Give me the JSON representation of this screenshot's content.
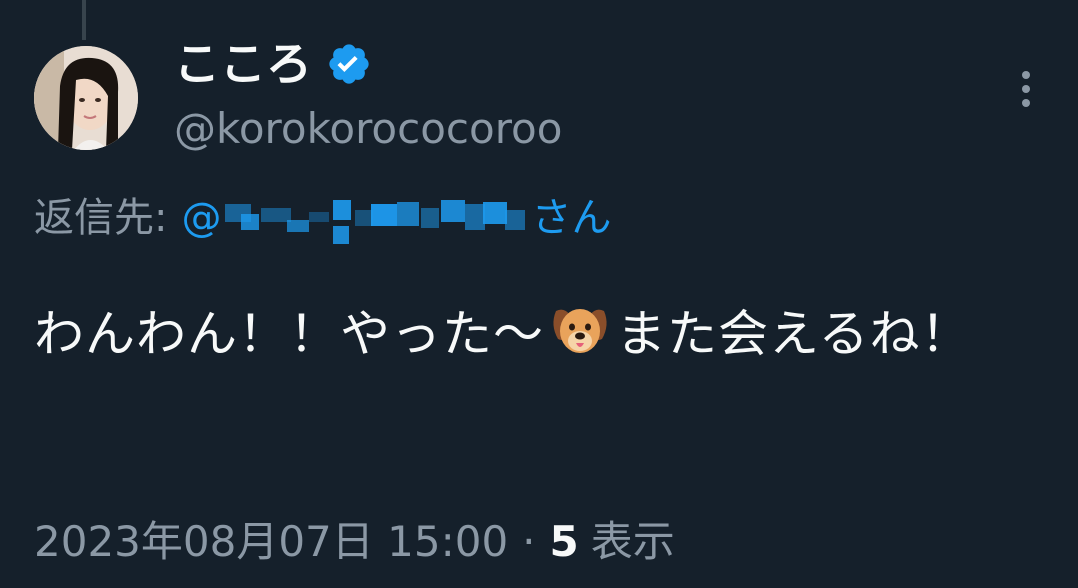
{
  "tweet": {
    "display_name": "こころ",
    "handle": "@korokorococoroo",
    "verified": true,
    "reply_prefix": "返信先:",
    "reply_mention_start": "@",
    "reply_mention_end": "さん",
    "text_part1": "わんわん！！やった〜",
    "emoji_name": "dog-face-emoji",
    "text_part2": "また会えるね！",
    "timestamp": "2023年08月07日 15:00",
    "separator": "·",
    "view_count": "5",
    "view_label": "表示"
  },
  "colors": {
    "background": "#15202b",
    "text_primary": "#f7f9f9",
    "text_secondary": "#8b98a5",
    "accent": "#1d9bf0"
  },
  "icons": {
    "verified": "verified-badge-icon",
    "more": "more-vertical-icon"
  }
}
